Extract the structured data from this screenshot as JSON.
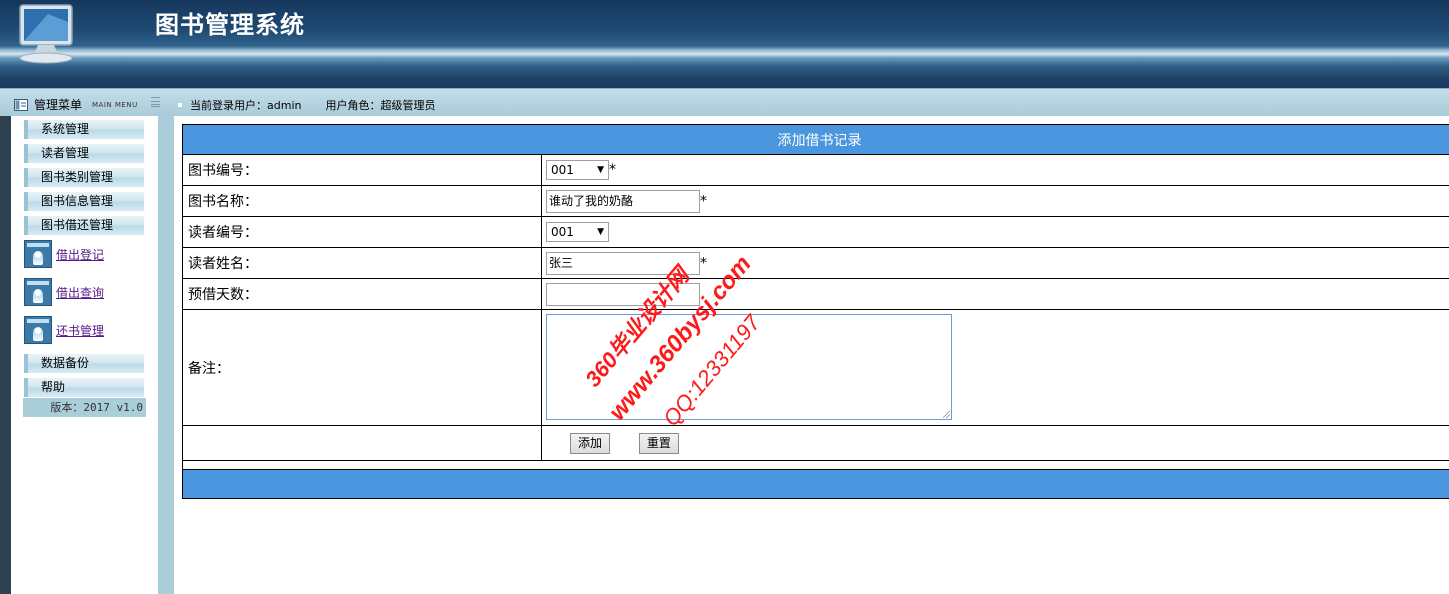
{
  "header": {
    "title": "图书管理系统"
  },
  "menu": {
    "title": "管理菜单",
    "subtitle": "MAIN MENU"
  },
  "user_info": {
    "user_label": "当前登录用户：admin",
    "role_label": "用户角色：超级管理员"
  },
  "sidebar": {
    "sections": [
      {
        "label": "系统管理"
      },
      {
        "label": "读者管理"
      },
      {
        "label": "图书类别管理"
      },
      {
        "label": "图书信息管理"
      },
      {
        "label": "图书借还管理"
      }
    ],
    "sub_items": [
      {
        "label": "借出登记"
      },
      {
        "label": "借出查询"
      },
      {
        "label": "还书管理"
      }
    ],
    "bottom_sections": [
      {
        "label": "数据备份"
      },
      {
        "label": "帮助"
      }
    ],
    "version": "版本：2017 v1.0"
  },
  "form": {
    "title": "添加借书记录",
    "book_id_label": "图书编号：",
    "book_id_value": "001",
    "book_name_label": "图书名称：",
    "book_name_value": "谁动了我的奶酪",
    "reader_id_label": "读者编号：",
    "reader_id_value": "001",
    "reader_name_label": "读者姓名：",
    "reader_name_value": "张三",
    "days_label": "预借天数：",
    "days_value": "",
    "remark_label": "备注：",
    "remark_value": "",
    "required_mark": "*",
    "submit_label": "添加",
    "reset_label": "重置"
  },
  "watermark": {
    "line1": "360毕业设计网",
    "line2": "www.360bysj.com",
    "line3": "QQ:12331197"
  },
  "colors": {
    "header_bar": "#4b97df",
    "watermark": "#ff0000",
    "link": "#551a8b"
  }
}
